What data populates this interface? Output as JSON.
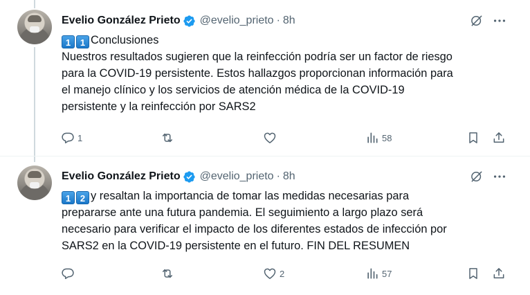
{
  "colors": {
    "text": "#0f1419",
    "secondary": "#536471",
    "verified": "#1d9bf0",
    "keycap": "#1b78c9",
    "divider": "#eff3f4"
  },
  "tweets": [
    {
      "name": "Evelio González Prieto",
      "handle": "@evelio_prieto",
      "dot": "·",
      "time": "8h",
      "keycaps": [
        "1",
        "1"
      ],
      "lines": [
        "Conclusiones",
        "Nuestros resultados sugieren que la reinfección podría ser un factor de riesgo",
        "para la COVID-19 persistente. Estos hallazgos proporcionan información para",
        "el manejo clínico y los servicios de atención médica de la COVID-19",
        "persistente y la reinfección por SARS2"
      ],
      "stats": {
        "replies": "1",
        "reposts": "",
        "likes": "",
        "views": "58"
      }
    },
    {
      "name": "Evelio González Prieto",
      "handle": "@evelio_prieto",
      "dot": "·",
      "time": "8h",
      "keycaps": [
        "1",
        "2"
      ],
      "lines": [
        "y resaltan la importancia de tomar las medidas necesarias para",
        "prepararse ante una futura pandemia. El seguimiento a largo plazo será",
        "necesario para verificar el impacto de los diferentes estados de infección por",
        "SARS2 en la COVID-19 persistente en el futuro. FIN DEL RESUMEN"
      ],
      "stats": {
        "replies": "",
        "reposts": "",
        "likes": "2",
        "views": "57"
      }
    }
  ],
  "icons": [
    "verified-badge-icon",
    "grok-icon",
    "more-icon",
    "reply-icon",
    "repost-icon",
    "like-icon",
    "views-icon",
    "bookmark-icon",
    "share-icon"
  ]
}
